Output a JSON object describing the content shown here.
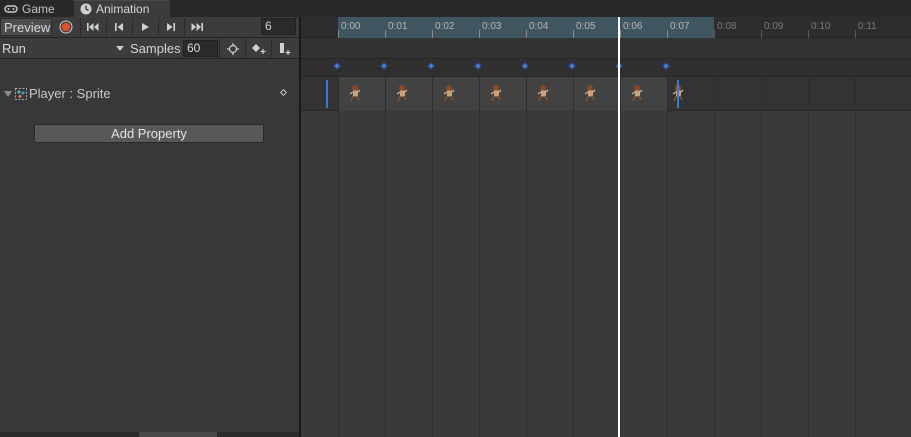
{
  "tabs": [
    {
      "label": "Game",
      "icon": "gamepad-icon"
    },
    {
      "label": "Animation",
      "icon": "clock-icon"
    }
  ],
  "toolbar": {
    "preview_label": "Preview",
    "frame": "6",
    "record_icon": "record-icon",
    "first_icon": "first-key-icon",
    "prev_icon": "prev-key-icon",
    "play_icon": "play-icon",
    "next_icon": "next-key-icon",
    "last_icon": "last-key-icon"
  },
  "clip": {
    "name": "Run",
    "samples_label": "Samples",
    "samples": "60"
  },
  "property": {
    "name": "Player : Sprite",
    "add_label": "Add Property"
  },
  "timeline": {
    "ticks": [
      "0:00",
      "0:01",
      "0:02",
      "0:03",
      "0:04",
      "0:05",
      "0:06",
      "0:07",
      "0:08",
      "0:09",
      "0:10",
      "0:11"
    ],
    "keyframe_count": 8,
    "current_frame": 6
  },
  "colors": {
    "accent": "#3a7bd5",
    "range_highlight": "#3f5560",
    "record": "#e0502e"
  }
}
